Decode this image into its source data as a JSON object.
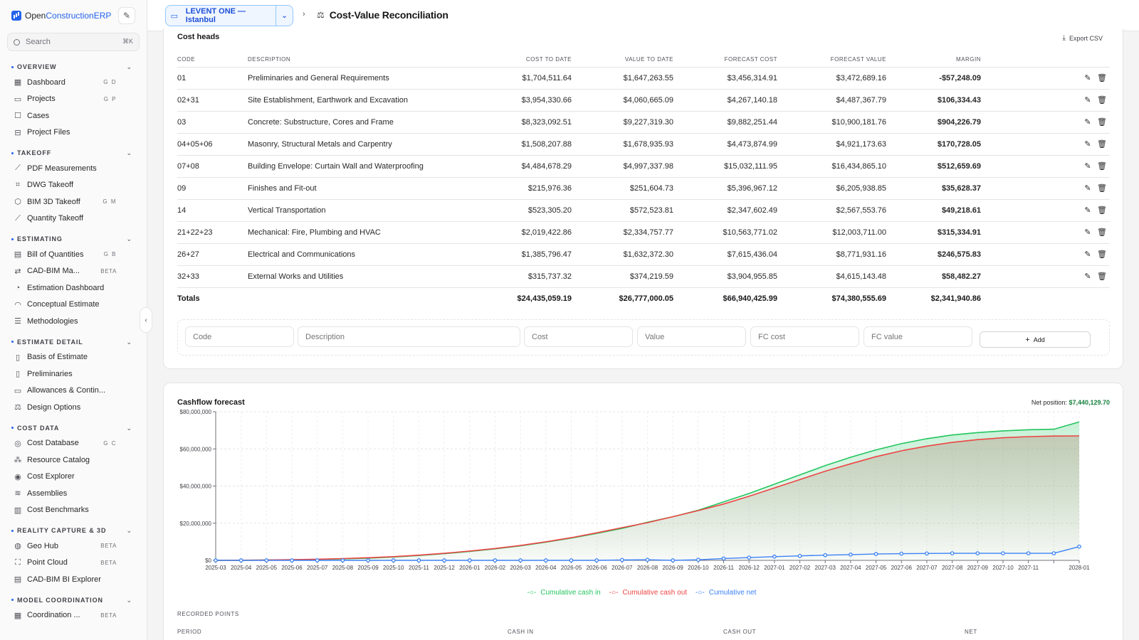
{
  "brand": {
    "name_part1": "Open",
    "name_part2": "ConstructionERP"
  },
  "sidebar": {
    "search_placeholder": "Search",
    "search_shortcut": "⌘K",
    "sections": [
      {
        "title": "OVERVIEW",
        "items": [
          {
            "label": "Dashboard",
            "icon": "grid-icon",
            "glyph": "▦",
            "hint": "G D"
          },
          {
            "label": "Projects",
            "icon": "folder-icon",
            "glyph": "▭",
            "hint": "G P"
          },
          {
            "label": "Cases",
            "icon": "square-icon",
            "glyph": "☐",
            "hint": ""
          },
          {
            "label": "Project Files",
            "icon": "drive-icon",
            "glyph": "⊟",
            "hint": ""
          }
        ]
      },
      {
        "title": "TAKEOFF",
        "items": [
          {
            "label": "PDF Measurements",
            "icon": "ruler-icon",
            "glyph": "⟋",
            "hint": ""
          },
          {
            "label": "DWG Takeoff",
            "icon": "drafting-icon",
            "glyph": "⌗",
            "hint": ""
          },
          {
            "label": "BIM 3D Takeoff",
            "icon": "cube-icon",
            "glyph": "⬡",
            "hint": "G M"
          },
          {
            "label": "Quantity Takeoff",
            "icon": "ruler-icon",
            "glyph": "⟋",
            "hint": ""
          }
        ]
      },
      {
        "title": "ESTIMATING",
        "items": [
          {
            "label": "Bill of Quantities",
            "icon": "table-icon",
            "glyph": "▤",
            "hint": "G B"
          },
          {
            "label": "CAD-BIM Ma...",
            "icon": "link-icon",
            "glyph": "⇄",
            "badge": "BETA"
          },
          {
            "label": "Estimation Dashboard",
            "icon": "chart-pie-icon",
            "glyph": "◔",
            "hint": ""
          },
          {
            "label": "Conceptual Estimate",
            "icon": "gauge-icon",
            "glyph": "◠",
            "hint": ""
          },
          {
            "label": "Methodologies",
            "icon": "sliders-icon",
            "glyph": "☰",
            "hint": ""
          }
        ]
      },
      {
        "title": "ESTIMATE DETAIL",
        "items": [
          {
            "label": "Basis of Estimate",
            "icon": "document-icon",
            "glyph": "▯",
            "hint": ""
          },
          {
            "label": "Preliminaries",
            "icon": "clipboard-icon",
            "glyph": "▯",
            "hint": ""
          },
          {
            "label": "Allowances & Contin...",
            "icon": "wallet-icon",
            "glyph": "▭",
            "hint": ""
          },
          {
            "label": "Design Options",
            "icon": "scale-icon",
            "glyph": "⚖",
            "hint": ""
          }
        ]
      },
      {
        "title": "COST DATA",
        "items": [
          {
            "label": "Cost Database",
            "icon": "database-icon",
            "glyph": "◎",
            "hint": "G C"
          },
          {
            "label": "Resource Catalog",
            "icon": "boxes-icon",
            "glyph": "⁂",
            "hint": ""
          },
          {
            "label": "Cost Explorer",
            "icon": "compass-icon",
            "glyph": "◉",
            "hint": ""
          },
          {
            "label": "Assemblies",
            "icon": "layers-icon",
            "glyph": "≋",
            "hint": ""
          },
          {
            "label": "Cost Benchmarks",
            "icon": "bar-chart-icon",
            "glyph": "▥",
            "hint": ""
          }
        ]
      },
      {
        "title": "REALITY CAPTURE & 3D",
        "items": [
          {
            "label": "Geo Hub",
            "icon": "globe-icon",
            "glyph": "◍",
            "badge": "BETA"
          },
          {
            "label": "Point Cloud",
            "icon": "scan-icon",
            "glyph": "⛶",
            "badge": "BETA"
          },
          {
            "label": "CAD-BIM BI Explorer",
            "icon": "table-icon",
            "glyph": "▤",
            "hint": ""
          }
        ]
      },
      {
        "title": "MODEL COORDINATION",
        "items": [
          {
            "label": "Coordination ...",
            "icon": "grid-icon",
            "glyph": "▦",
            "badge": "BETA"
          }
        ]
      }
    ]
  },
  "header": {
    "project": "LEVENT ONE — Istanbul",
    "page_title": "Cost-Value Reconciliation"
  },
  "cost_heads": {
    "title": "Cost heads",
    "export_label": "Export CSV",
    "columns": [
      "CODE",
      "DESCRIPTION",
      "COST TO DATE",
      "VALUE TO DATE",
      "FORECAST COST",
      "FORECAST VALUE",
      "MARGIN"
    ],
    "rows": [
      {
        "code": "01",
        "description": "Preliminaries and General Requirements",
        "cost": "$1,704,511.64",
        "value": "$1,647,263.55",
        "fc": "$3,456,314.91",
        "fv": "$3,472,689.16",
        "margin": "-$57,248.09",
        "neg": true
      },
      {
        "code": "02+31",
        "description": "Site Establishment, Earthwork and Excavation",
        "cost": "$3,954,330.66",
        "value": "$4,060,665.09",
        "fc": "$4,267,140.18",
        "fv": "$4,487,367.79",
        "margin": "$106,334.43",
        "neg": false
      },
      {
        "code": "03",
        "description": "Concrete: Substructure, Cores and Frame",
        "cost": "$8,323,092.51",
        "value": "$9,227,319.30",
        "fc": "$9,882,251.44",
        "fv": "$10,900,181.76",
        "margin": "$904,226.79",
        "neg": false
      },
      {
        "code": "04+05+06",
        "description": "Masonry, Structural Metals and Carpentry",
        "cost": "$1,508,207.88",
        "value": "$1,678,935.93",
        "fc": "$4,473,874.99",
        "fv": "$4,921,173.63",
        "margin": "$170,728.05",
        "neg": false
      },
      {
        "code": "07+08",
        "description": "Building Envelope: Curtain Wall and Waterproofing",
        "cost": "$4,484,678.29",
        "value": "$4,997,337.98",
        "fc": "$15,032,111.95",
        "fv": "$16,434,865.10",
        "margin": "$512,659.69",
        "neg": false
      },
      {
        "code": "09",
        "description": "Finishes and Fit-out",
        "cost": "$215,976.36",
        "value": "$251,604.73",
        "fc": "$5,396,967.12",
        "fv": "$6,205,938.85",
        "margin": "$35,628.37",
        "neg": false
      },
      {
        "code": "14",
        "description": "Vertical Transportation",
        "cost": "$523,305.20",
        "value": "$572,523.81",
        "fc": "$2,347,602.49",
        "fv": "$2,567,553.76",
        "margin": "$49,218.61",
        "neg": false
      },
      {
        "code": "21+22+23",
        "description": "Mechanical: Fire, Plumbing and HVAC",
        "cost": "$2,019,422.86",
        "value": "$2,334,757.77",
        "fc": "$10,563,771.02",
        "fv": "$12,003,711.00",
        "margin": "$315,334.91",
        "neg": false
      },
      {
        "code": "26+27",
        "description": "Electrical and Communications",
        "cost": "$1,385,796.47",
        "value": "$1,632,372.30",
        "fc": "$7,615,436.04",
        "fv": "$8,771,931.16",
        "margin": "$246,575.83",
        "neg": false
      },
      {
        "code": "32+33",
        "description": "External Works and Utilities",
        "cost": "$315,737.32",
        "value": "$374,219.59",
        "fc": "$3,904,955.85",
        "fv": "$4,615,143.48",
        "margin": "$58,482.27",
        "neg": false
      }
    ],
    "totals": {
      "label": "Totals",
      "cost": "$24,435,059.19",
      "value": "$26,777,000.05",
      "fc": "$66,940,425.99",
      "fv": "$74,380,555.69",
      "margin": "$2,341,940.86"
    },
    "add_form": {
      "code_ph": "Code",
      "desc_ph": "Description",
      "cost_ph": "Cost",
      "value_ph": "Value",
      "fc_ph": "FC cost",
      "fv_ph": "FC value",
      "add_label": "Add"
    }
  },
  "cashflow": {
    "title": "Cashflow forecast",
    "net_label": "Net position:",
    "net_value": "$7,440,129.70",
    "recorded_label": "RECORDED POINTS",
    "recorded_columns": [
      "PERIOD",
      "CASH IN",
      "CASH OUT",
      "NET"
    ]
  },
  "chart_data": {
    "type": "line",
    "title": "Cashflow forecast",
    "x": [
      "2025-03",
      "2025-04",
      "2025-05",
      "2025-06",
      "2025-07",
      "2025-08",
      "2025-09",
      "2025-10",
      "2025-11",
      "2025-12",
      "2026-01",
      "2026-02",
      "2026-03",
      "2026-04",
      "2026-05",
      "2026-06",
      "2026-07",
      "2026-08",
      "2026-09",
      "2026-10",
      "2026-11",
      "2026-12",
      "2027-01",
      "2027-02",
      "2027-03",
      "2027-04",
      "2027-05",
      "2027-06",
      "2027-07",
      "2027-08",
      "2027-09",
      "2027-10",
      "2027-11",
      "2027-12",
      "2028-01"
    ],
    "xtick_labels": [
      "2025-03",
      "2025-04",
      "2025-05",
      "2025-06",
      "2025-07",
      "2025-08",
      "2025-09",
      "2025-10",
      "2025-11",
      "2025-12",
      "2026-01",
      "2026-02",
      "2026-03",
      "2026-04",
      "2026-05",
      "2026-06",
      "2026-07",
      "2026-08",
      "2026-09",
      "2026-10",
      "2026-11",
      "2026-12",
      "2027-01",
      "2027-02",
      "2027-03",
      "2027-04",
      "2027-05",
      "2027-06",
      "2027-07",
      "2027-08",
      "2027-09",
      "2027-10",
      "2027-11",
      "",
      "2028-01"
    ],
    "ytick_labels": [
      "$0",
      "$20,000,000",
      "$40,000,000",
      "$60,000,000",
      "$80,000,000"
    ],
    "ylim": [
      0,
      80000000
    ],
    "series": [
      {
        "name": "Cumulative cash in",
        "color": "#22c55e",
        "values": [
          0,
          50000,
          150000,
          300000,
          500000,
          800000,
          1200000,
          1800000,
          2600000,
          3600000,
          4800000,
          6200000,
          7800000,
          9800000,
          12000000,
          14500000,
          17200000,
          20500000,
          23500000,
          27000000,
          31500000,
          36000000,
          41000000,
          46000000,
          51000000,
          55500000,
          59500000,
          62800000,
          65500000,
          67500000,
          68800000,
          69700000,
          70300000,
          70600000,
          74500000
        ]
      },
      {
        "name": "Cumulative cash out",
        "color": "#ef4444",
        "values": [
          0,
          80000,
          200000,
          380000,
          600000,
          950000,
          1400000,
          2000000,
          2800000,
          3800000,
          5000000,
          6400000,
          8000000,
          10000000,
          12200000,
          14800000,
          17600000,
          20300000,
          23500000,
          26800000,
          30300000,
          34500000,
          39000000,
          43500000,
          48000000,
          52000000,
          55800000,
          59000000,
          61500000,
          63500000,
          65000000,
          66000000,
          66600000,
          66900000,
          67000000
        ]
      },
      {
        "name": "Cumulative net",
        "color": "#3b82f6",
        "values": [
          0,
          0,
          0,
          0,
          0,
          0,
          0,
          0,
          0,
          0,
          0,
          0,
          0,
          0,
          0,
          0,
          200000,
          300000,
          0,
          300000,
          1000000,
          1500000,
          2000000,
          2400000,
          2800000,
          3100000,
          3400000,
          3600000,
          3700000,
          3800000,
          3800000,
          3800000,
          3800000,
          3800000,
          7400000
        ]
      }
    ],
    "legend_position": "bottom",
    "grid": true
  },
  "colors": {
    "accent": "#2563eb",
    "positive": "#15803d",
    "negative": "#dc2626"
  }
}
